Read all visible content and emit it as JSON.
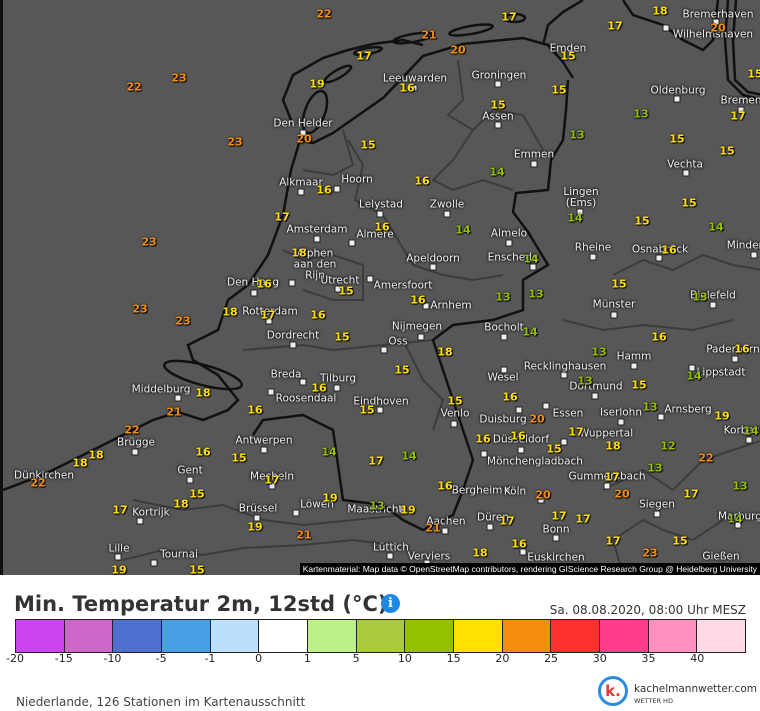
{
  "header": {
    "title": "Min. Temperatur 2m, 12std (°C)",
    "info_icon": "i",
    "date": "Sa. 08.08.2020, 08:00 Uhr MESZ"
  },
  "legend": {
    "colors": [
      "#cc44ee",
      "#cc66c8",
      "#5070d0",
      "#48a0e4",
      "#bce0fc",
      "#ffffff",
      "#bcf088",
      "#aacc3c",
      "#94c000",
      "#ffe000",
      "#f48c10",
      "#ff3030",
      "#ff3c8c",
      "#ff90c0",
      "#ffd8e8"
    ],
    "ticks": [
      "-20",
      "-15",
      "-10",
      "-5",
      "-1",
      "0",
      "1",
      "5",
      "10",
      "15",
      "20",
      "25",
      "30",
      "35",
      "40"
    ],
    "bounds": [
      -20,
      -15,
      -10,
      -5,
      -1,
      0,
      1,
      5,
      10,
      15,
      20,
      25,
      30,
      35,
      40
    ]
  },
  "footer": {
    "stations": "Niederlande, 126 Stationen im Kartenausschnitt",
    "brand": "kachelmannwetter.com",
    "brand_sub": "WETTER HD",
    "logo_letter": "k."
  },
  "map": {
    "attribution": "Kartenmaterial: Map data © OpenStreetMap contributors, rendering GIScience Research Group @ Heidelberg University",
    "cities": [
      "Bremerhaven",
      "Wilhelmshaven",
      "Emden",
      "Leeuwarden",
      "Groningen",
      "Oldenburg",
      "Bremen",
      "Assen",
      "Den Helder",
      "Emmen",
      "Vechta",
      "Alkmaar",
      "Hoorn",
      "Lingen\n(Ems)",
      "Lelystad",
      "Zwolle",
      "Amsterdam",
      "Almere",
      "Almelo",
      "Rheine",
      "Osnabrück",
      "Minden",
      "Alphen\naan den\nRijn",
      "Utrecht",
      "Amersfoort",
      "Apeldoorn",
      "Enschede",
      "Den Haag",
      "Arnhem",
      "Münster",
      "Bielefeld",
      "Rotterdam",
      "Dordrecht",
      "Nijmegen",
      "Oss",
      "Bocholt",
      "Paderborn",
      "Hamm",
      "Recklinghausen",
      "Wesel",
      "Lippstadt",
      "Dortmund",
      "Breda",
      "Tilburg",
      "Middelburg",
      "Roosendaal",
      "Eindhoven",
      "Venlo",
      "Duisburg",
      "Essen",
      "Iserlohn",
      "Arnsberg",
      "Korbach",
      "Antwerpen",
      "Düsseldorf",
      "Wuppertal",
      "Brügge",
      "Mönchengladbach",
      "Gent",
      "Dünkirchen",
      "Mecheln",
      "Gummersbach",
      "Bergheim",
      "Köln",
      "Löwen",
      "Maastricht",
      "Siegen",
      "Kortrijk",
      "Brüssel",
      "Marburg",
      "Aachen",
      "Düren",
      "Bonn",
      "Lille",
      "Tournai",
      "Lüttich",
      "Verviers",
      "Euskirchen",
      "Gießen"
    ],
    "temperatures": [
      22,
      17,
      18,
      17,
      21,
      20,
      17,
      15,
      20,
      15,
      23,
      22,
      19,
      16,
      15,
      15,
      13,
      17,
      23,
      20,
      15,
      13,
      15,
      15,
      16,
      16,
      14,
      15,
      17,
      14,
      15,
      14,
      16,
      14,
      23,
      18,
      14,
      16,
      15,
      16,
      15,
      13,
      13,
      13,
      16,
      23,
      23,
      18,
      17,
      16,
      15,
      14,
      16,
      18,
      13,
      16,
      15,
      13,
      15,
      14,
      16,
      18,
      16,
      21,
      16,
      15,
      15,
      20,
      13,
      19,
      22,
      17,
      14,
      18,
      18,
      16,
      15,
      16,
      16,
      15,
      18,
      12,
      14,
      17,
      14,
      22,
      13,
      22,
      17,
      17,
      16,
      20,
      20,
      15,
      18,
      19,
      17,
      13,
      13,
      19,
      17,
      19,
      21,
      17,
      17,
      17,
      14,
      21,
      16,
      17,
      15,
      18,
      23,
      19,
      15
    ]
  }
}
